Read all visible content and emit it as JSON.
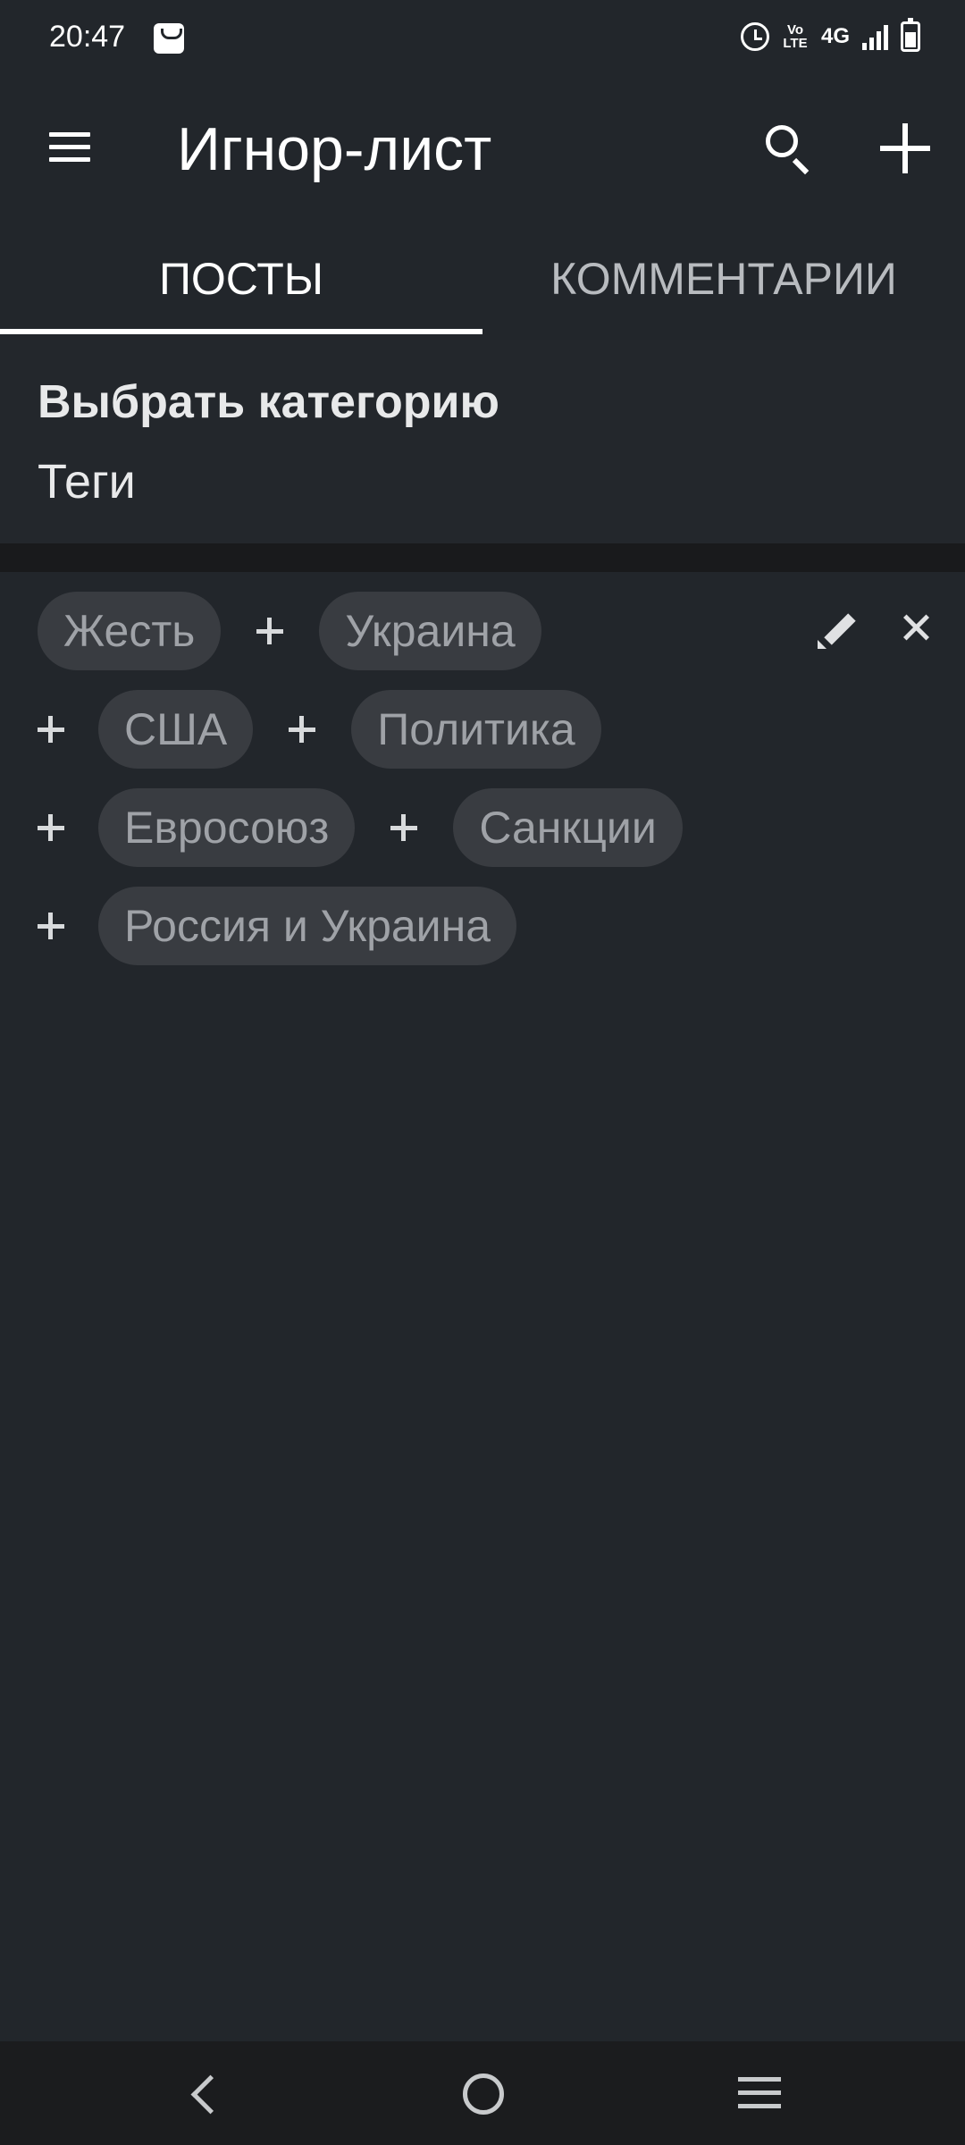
{
  "status_bar": {
    "time": "20:47",
    "indicators": {
      "volte": "Vo\nLTE",
      "network": "4G"
    },
    "icons": [
      "shopping-bag-icon",
      "alarm-icon",
      "volte-icon",
      "signal-icon",
      "battery-icon"
    ]
  },
  "app_bar": {
    "title": "Игнор-лист",
    "icons": [
      "menu-icon",
      "search-icon",
      "add-icon"
    ]
  },
  "tabs": [
    {
      "label": "ПОСТЫ",
      "active": true
    },
    {
      "label": "КОММЕНТАРИИ",
      "active": false
    }
  ],
  "category": {
    "header": "Выбрать категорию",
    "value": "Теги"
  },
  "tags": {
    "rows": [
      [
        "Жесть",
        "Украина"
      ],
      [
        "США",
        "Политика"
      ],
      [
        "Евросоюз",
        "Санкции"
      ],
      [
        "Россия и Украина"
      ]
    ],
    "actions": [
      "edit-icon",
      "close-icon"
    ]
  },
  "nav_bar": {
    "icons": [
      "back-icon",
      "home-icon",
      "recents-icon"
    ]
  },
  "colors": {
    "background": "#22262b",
    "chip_background": "#393c41",
    "chip_text": "#9fa2a7",
    "tab_indicator": "#ffffff",
    "nav_bar": "#1b1c1e"
  }
}
